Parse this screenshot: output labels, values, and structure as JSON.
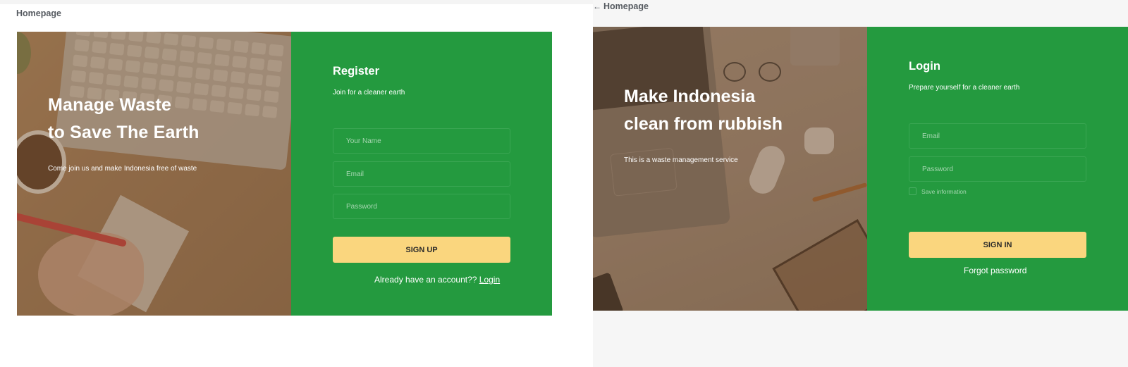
{
  "left": {
    "home_label": "Homepage",
    "hero": {
      "title_line1": "Manage Waste",
      "title_line2": "to Save The Earth",
      "subtitle": "Come join us and make Indonesia free of waste"
    },
    "form": {
      "title": "Register",
      "subtitle": "Join for a cleaner earth",
      "name_placeholder": "Your Name",
      "email_placeholder": "Email",
      "password_placeholder": "Password",
      "submit_label": "SIGN UP",
      "already_text": "Already have an account??",
      "login_link": "Login"
    }
  },
  "right": {
    "home_label": "Homepage",
    "back_arrow_icon": "arrow-left-icon",
    "hero": {
      "title_line1": "Make Indonesia",
      "title_line2": "clean from rubbish",
      "subtitle": "This is a waste management service"
    },
    "form": {
      "title": "Login",
      "subtitle": "Prepare yourself for a cleaner earth",
      "email_placeholder": "Email",
      "password_placeholder": "Password",
      "save_label": "Save information",
      "submit_label": "SIGN IN",
      "forgot_label": "Forgot password"
    }
  },
  "colors": {
    "brand_green": "#249a3f",
    "button_yellow": "#fad67e",
    "text_white": "#ffffff"
  }
}
